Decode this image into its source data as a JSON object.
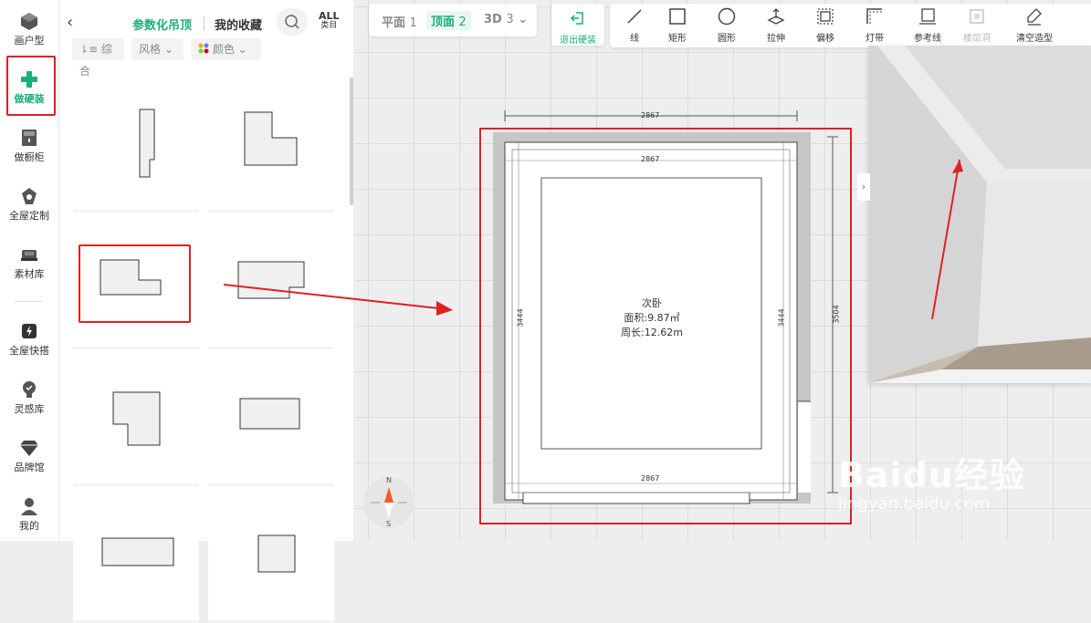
{
  "rail": {
    "items": [
      {
        "label": "画户型",
        "icon": "house-icon"
      },
      {
        "label": "做硬装",
        "icon": "hard-decor-icon",
        "active": true
      },
      {
        "label": "做橱柜",
        "icon": "cabinet-icon"
      },
      {
        "label": "全屋定制",
        "icon": "custom-icon"
      },
      {
        "label": "素材库",
        "icon": "sofa-icon"
      },
      {
        "label": "全屋快搭",
        "icon": "lightning-icon"
      },
      {
        "label": "灵感库",
        "icon": "bulb-icon"
      },
      {
        "label": "品牌馆",
        "icon": "diamond-icon"
      },
      {
        "label": "我的",
        "icon": "user-icon"
      }
    ]
  },
  "panel": {
    "active_tab": "参数化吊顶",
    "fav_tab": "我的收藏",
    "all_label_top": "ALL",
    "all_label_bottom": "类目",
    "filters": [
      {
        "label": "综合",
        "icon": "sort-icon"
      },
      {
        "label": "风格",
        "icon": "chevron-down-icon"
      },
      {
        "label": "颜色",
        "icon": "palette-icon"
      }
    ]
  },
  "canvas": {
    "view_switch": [
      {
        "label": "平面",
        "num": "1"
      },
      {
        "label": "顶面",
        "num": "2",
        "active": true
      },
      {
        "label": "3D",
        "num": "3"
      }
    ],
    "exit_label": "退出硬装",
    "tools": [
      {
        "label": "线",
        "icon": "line-icon"
      },
      {
        "label": "矩形",
        "icon": "rectangle-icon"
      },
      {
        "label": "圆形",
        "icon": "circle-icon"
      },
      {
        "label": "拉伸",
        "icon": "extrude-icon"
      },
      {
        "label": "偏移",
        "icon": "offset-icon"
      },
      {
        "label": "灯带",
        "icon": "light-strip-icon"
      },
      {
        "label": "参考线",
        "icon": "guide-line-icon"
      },
      {
        "label": "楼层洞",
        "icon": "floor-hole-icon",
        "disabled": true
      },
      {
        "label": "清空造型",
        "icon": "eraser-icon"
      }
    ],
    "room": {
      "name": "次卧",
      "area": "面积:9.87㎡",
      "perimeter": "周长:12.62m"
    },
    "dims": {
      "top_outer": "2867",
      "top_inner": "2867",
      "bottom": "2867",
      "left": "3444",
      "right": "3444",
      "right_outer": "3504"
    },
    "compass": {
      "north": "N",
      "south": "S"
    },
    "watermark": {
      "brand": "Baidu经验",
      "url": "jingyan.baidu.com"
    }
  },
  "colors": {
    "accent": "#1aaf7a",
    "highlight": "#e02020"
  }
}
